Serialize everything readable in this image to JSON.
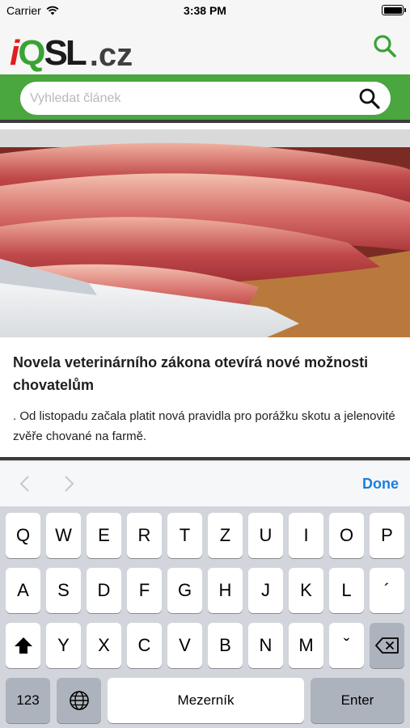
{
  "status_bar": {
    "carrier": "Carrier",
    "time": "3:38 PM"
  },
  "header": {
    "logo": {
      "i": "i",
      "q": "Q",
      "sl": "SL",
      "tld": ".cz"
    },
    "search_icon": "search-icon"
  },
  "search": {
    "placeholder": "Vyhledat článek",
    "icon": "magnifier-icon"
  },
  "article": {
    "image": "raw-meat-photo",
    "title": "Novela veterinárního zákona otevírá nové možnosti chovatelům",
    "excerpt": ". Od listopadu začala platit nová pravidla pro porážku skotu a jelenovité zvěře chované na farmě."
  },
  "accessory": {
    "prev_icon": "chevron-left-icon",
    "next_icon": "chevron-right-icon",
    "done": "Done"
  },
  "keyboard": {
    "row1": [
      "Q",
      "W",
      "E",
      "R",
      "T",
      "Z",
      "U",
      "I",
      "O",
      "P"
    ],
    "row2": [
      "A",
      "S",
      "D",
      "F",
      "G",
      "H",
      "J",
      "K",
      "L",
      "´"
    ],
    "row3": [
      "Y",
      "X",
      "C",
      "V",
      "B",
      "N",
      "M",
      "ˇ"
    ],
    "numbers": "123",
    "space": "Mezerník",
    "enter": "Enter",
    "shift_icon": "shift-icon",
    "globe_icon": "globe-icon",
    "delete_icon": "delete-icon"
  },
  "colors": {
    "brand_green": "#4aa63e",
    "brand_red": "#e11d1d",
    "link_blue": "#1a7fe0"
  }
}
